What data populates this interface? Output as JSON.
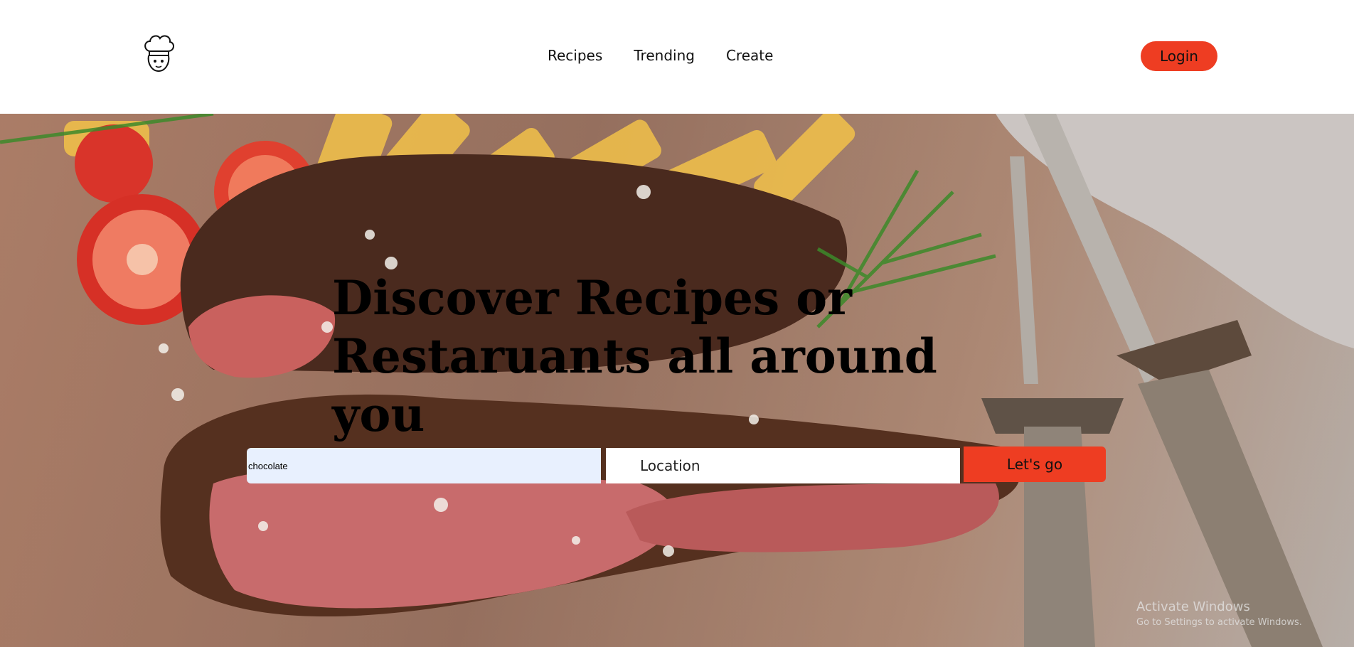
{
  "header": {
    "logo_icon": "chef-hat-icon",
    "nav": [
      {
        "label": "Recipes"
      },
      {
        "label": "Trending"
      },
      {
        "label": "Create"
      }
    ],
    "login_label": "Login"
  },
  "hero": {
    "headline": "Discover Recipes or Restaruants all around you",
    "background": "steak-photo",
    "search": {
      "value": "chocolate"
    },
    "location": {
      "placeholder": "Location"
    },
    "go_label": "Let's go"
  },
  "watermark": {
    "line1": "Activate Windows",
    "line2": "Go to Settings to activate Windows."
  },
  "colors": {
    "accent": "#ee3d22",
    "search_bg": "#e8f0fe"
  }
}
